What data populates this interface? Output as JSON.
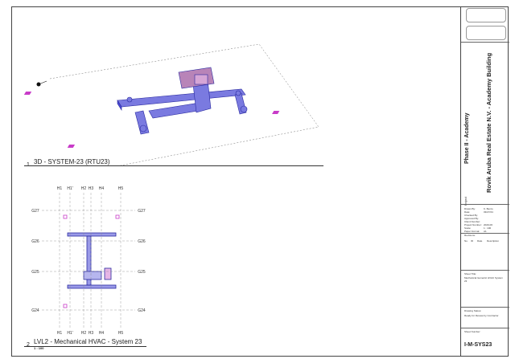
{
  "titleblock": {
    "project_label": "Project",
    "phase": "Phase II - Academy",
    "project_name": "Rovik Aruba Real Estate N.V. - Academy Building",
    "fields": [
      {
        "label": "Drawn By:",
        "value": "K. Bento"
      },
      {
        "label": "Date:",
        "value": "03/27/24"
      },
      {
        "label": "Checked By:",
        "value": ""
      },
      {
        "label": "Approved By:",
        "value": ""
      },
      {
        "label": "Client Number:",
        "value": ""
      },
      {
        "label": "Project Number:",
        "value": "2020-06"
      },
      {
        "label": "Scale:",
        "value": "1 : 100"
      },
      {
        "label": "Paper Format:",
        "value": "A1"
      }
    ],
    "revisions_label": "Revisions:",
    "revision_cols": [
      "No.",
      "ID",
      "Date",
      "Description"
    ],
    "sheet_title_label": "Sheet Title:",
    "sheet_title": "Mechanical Isometric HVAC System 23",
    "status_label": "Drawing Status:",
    "status": "Ready for Review by Contractor",
    "sheet_number_label": "Sheet Number:",
    "sheet_number": "I-M-SYS23"
  },
  "view1": {
    "number": "1",
    "title": "3D - SYSTEM-23 (RTU23)"
  },
  "view2": {
    "number": "2",
    "title": "LVL2 - Mechanical HVAC - System 23",
    "scale": "1 : 100"
  },
  "grid": {
    "cols": [
      "H1",
      "H1'",
      "H2",
      "H3",
      "H4",
      "H5"
    ],
    "rows": [
      "G27",
      "G26",
      "G25",
      "G24"
    ]
  },
  "colors": {
    "duct": "#4a4ad6",
    "tag": "#c83cc8",
    "line": "#333333"
  }
}
